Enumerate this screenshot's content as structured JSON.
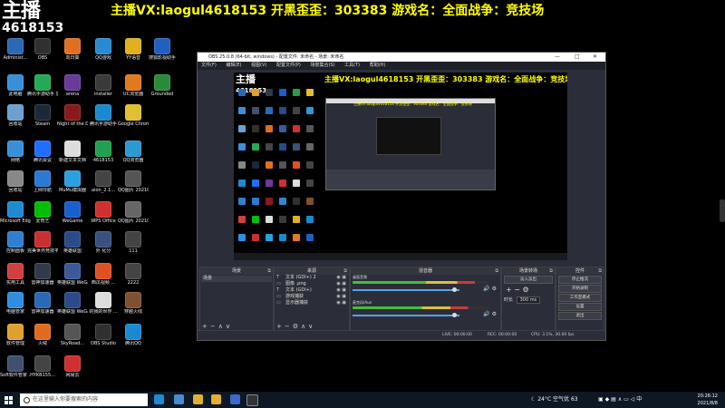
{
  "overlay": {
    "logo_text": "主播",
    "room_number": "4618153",
    "banner": "主播VX:laogul4618153 开黑歪歪：303383 游戏名：全面战争：竞技场"
  },
  "desktop_icons": [
    {
      "label": "Administ...",
      "color": "#2a6ab5"
    },
    {
      "label": "此电脑",
      "color": "#3a8fd9"
    },
    {
      "label": "回收站",
      "color": "#6ca0d0"
    },
    {
      "label": "网络",
      "color": "#3a8fd9"
    },
    {
      "label": "回收站",
      "color": "#888888"
    },
    {
      "label": "Microsoft Edge",
      "color": "#1f8ad2"
    },
    {
      "label": "控制面板",
      "color": "#2f7fd0"
    },
    {
      "label": "实用工具",
      "color": "#d04040"
    },
    {
      "label": "电脑管家",
      "color": "#2e8fe0"
    },
    {
      "label": "软件管理",
      "color": "#e0a030"
    },
    {
      "label": "Soft软件管家 ...",
      "color": "#405070"
    },
    {
      "label": "OBS",
      "color": "#303030"
    },
    {
      "label": "腾讯手游助手 加速器",
      "color": "#22aa55"
    },
    {
      "label": "Steam",
      "color": "#1b2838"
    },
    {
      "label": "腾讯会议",
      "color": "#1e6fff"
    },
    {
      "label": "上网导航",
      "color": "#2a7ad5"
    },
    {
      "label": "爱奇艺",
      "color": "#00be06"
    },
    {
      "label": "完美世界竞技平台",
      "color": "#c83030"
    },
    {
      "label": "雷神加速器",
      "color": "#303a4a"
    },
    {
      "label": "雷神加速器",
      "color": "#2a6ab5"
    },
    {
      "label": "火绒",
      "color": "#e06a20"
    },
    {
      "label": "HYKB155...",
      "color": "#444444"
    },
    {
      "label": "向日葵",
      "color": "#e07020"
    },
    {
      "label": "arena",
      "color": "#6a3a9a"
    },
    {
      "label": "Night of the Dead",
      "color": "#8a1a1a"
    },
    {
      "label": "新建文本文档",
      "color": "#dddddd"
    },
    {
      "label": "MuMu模拟器",
      "color": "#2aa0e0"
    },
    {
      "label": "WeGame",
      "color": "#1a5fd0"
    },
    {
      "label": "英雄联盟",
      "color": "#2a4a8a"
    },
    {
      "label": "英雄联盟 WeGame版",
      "color": "#3a5a9a"
    },
    {
      "label": "英雄联盟 WeGame版",
      "color": "#2a4a8a"
    },
    {
      "label": "SkyRoad...",
      "color": "#555555"
    },
    {
      "label": "网易云",
      "color": "#d03030"
    },
    {
      "label": "QQ游戏",
      "color": "#2a8ad0"
    },
    {
      "label": "installer",
      "color": "#3a3a3a"
    },
    {
      "label": "腾讯手游助手",
      "color": "#1a8ad0"
    },
    {
      "label": "4618153",
      "color": "#20a050"
    },
    {
      "label": "aion_2.1...",
      "color": "#444444"
    },
    {
      "label": "WPS Office",
      "color": "#d03030"
    },
    {
      "label": "外 化分",
      "color": "#3a5080"
    },
    {
      "label": "西瓜视频 ...",
      "color": "#e05020"
    },
    {
      "label": "的我的世界 ...",
      "color": "#dddddd"
    },
    {
      "label": "OBS Studio",
      "color": "#303030"
    },
    {
      "label": "YY语音",
      "color": "#e0b020"
    },
    {
      "label": "UC浏览器",
      "color": "#e07a20"
    },
    {
      "label": "Google Chrome",
      "color": "#e0c030"
    },
    {
      "label": "QQ浏览器",
      "color": "#2a9ad0"
    },
    {
      "label": "QQ图片 20210803...",
      "color": "#555555"
    },
    {
      "label": "QQ图片 20210803...",
      "color": "#666666"
    },
    {
      "label": "111",
      "color": "#444444"
    },
    {
      "label": "2222",
      "color": "#444444"
    },
    {
      "label": "穿越火线",
      "color": "#805030"
    },
    {
      "label": "腾讯QQ",
      "color": "#1a8ad0"
    },
    {
      "label": "搜狐影视助手",
      "color": "#2060c0"
    },
    {
      "label": "Grounded",
      "color": "#2a8a3a"
    }
  ],
  "obs": {
    "title": "OBS 25.0.8 (64-bit, windows) - 配置文件: 未命名 - 场景: 未命名",
    "menu": [
      "文件(F)",
      "编辑(E)",
      "视图(V)",
      "配置文件(P)",
      "场景集合(S)",
      "工具(T)",
      "帮助(H)"
    ],
    "preview_banner": "主播VX:laogul4618153 开黑歪歪：303383 游戏名：全面战争：竞技场",
    "inner_banner": "主播VX:laogul4618153 开黑歪歪：303383 游戏名：全面战争：竞技场",
    "panels": {
      "scenes_title": "场景",
      "sources_title": "来源",
      "mixer_title": "混音器",
      "transitions_title": "场景转场",
      "controls_title": "控件"
    },
    "scenes": [
      "场景"
    ],
    "sources": [
      {
        "type": "T",
        "name": "文本 (GDI+) 2"
      },
      {
        "type": "▭",
        "name": "图像 .png"
      },
      {
        "type": "T",
        "name": "文本 (GDI+)"
      },
      {
        "type": "▭",
        "name": "游戏捕获"
      },
      {
        "type": "▭",
        "name": "显示器捕获"
      }
    ],
    "mixer": [
      {
        "label": "桌面音频",
        "level": 0.9
      },
      {
        "label": "麦克风/Aux",
        "level": 0.85
      }
    ],
    "transition": {
      "name": "淡入淡出",
      "duration_label": "时长",
      "duration_value": "300 ms"
    },
    "controls": [
      "停止推流",
      "开始录制",
      "工作室模式",
      "设置",
      "退出"
    ],
    "status": {
      "live": "LIVE: 00:00:00",
      "rec": "REC: 00:00:00",
      "cpu": "CPU: 3.1%, 30.00 fps"
    }
  },
  "taskbar": {
    "search_placeholder": "在这里输入你要搜索的内容",
    "temperature": "24°C 空气优 63",
    "time": "20:26:12",
    "date": "2021/8/8",
    "tray_text": "中"
  }
}
